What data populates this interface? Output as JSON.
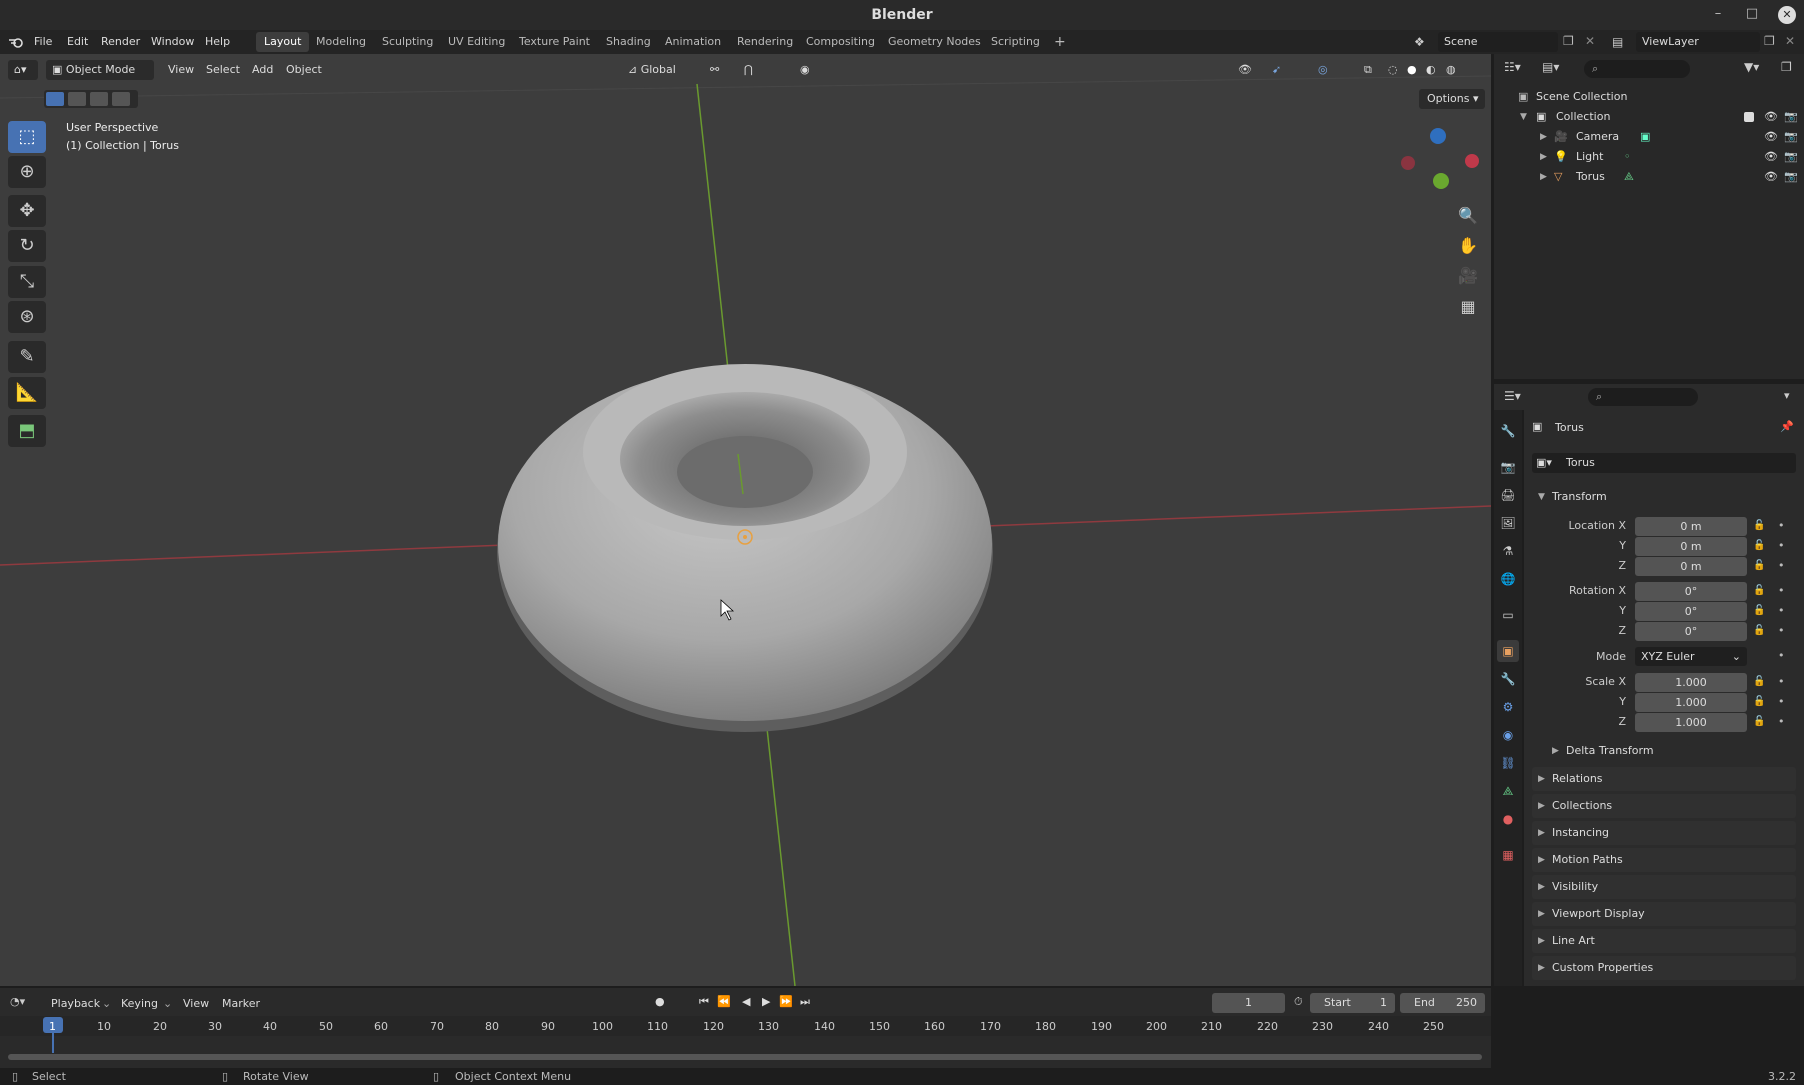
{
  "app": {
    "window_title": "Blender",
    "version": "3.2.2",
    "accent": "#4772b3"
  },
  "menubar": {
    "items": [
      "File",
      "Edit",
      "Render",
      "Window",
      "Help"
    ],
    "workspaces": [
      "Layout",
      "Modeling",
      "Sculpting",
      "UV Editing",
      "Texture Paint",
      "Shading",
      "Animation",
      "Rendering",
      "Compositing",
      "Geometry Nodes",
      "Scripting"
    ],
    "active_workspace": "Layout",
    "scene": "Scene",
    "view_layer": "ViewLayer"
  },
  "viewport": {
    "mode": "Object Mode",
    "menus": [
      "View",
      "Select",
      "Add",
      "Object"
    ],
    "transform_orientation": "Global",
    "options_label": "Options",
    "overlay_title": "User Perspective",
    "overlay_subtitle": "(1) Collection | Torus"
  },
  "outliner": {
    "scene_collection": "Scene Collection",
    "collection": "Collection",
    "objects": [
      "Camera",
      "Light",
      "Torus"
    ]
  },
  "properties": {
    "object_name": "Torus",
    "data_name": "Torus",
    "transform_label": "Transform",
    "location_label": "Location X",
    "rotation_label": "Rotation X",
    "scale_label": "Scale X",
    "y_label": "Y",
    "z_label": "Z",
    "location": [
      "0 m",
      "0 m",
      "0 m"
    ],
    "rotation": [
      "0°",
      "0°",
      "0°"
    ],
    "mode_label": "Mode",
    "mode_value": "XYZ Euler",
    "scale": [
      "1.000",
      "1.000",
      "1.000"
    ],
    "delta_transform": "Delta Transform",
    "panels": [
      "Relations",
      "Collections",
      "Instancing",
      "Motion Paths",
      "Visibility",
      "Viewport Display",
      "Line Art",
      "Custom Properties"
    ]
  },
  "timeline": {
    "menus": [
      "Playback",
      "Keying",
      "View",
      "Marker"
    ],
    "current_frame": "1",
    "start_label": "Start",
    "start_value": "1",
    "end_label": "End",
    "end_value": "250",
    "ruler": [
      "1",
      "10",
      "20",
      "30",
      "40",
      "50",
      "60",
      "70",
      "80",
      "90",
      "100",
      "110",
      "120",
      "130",
      "140",
      "150",
      "160",
      "170",
      "180",
      "190",
      "200",
      "210",
      "220",
      "230",
      "240",
      "250"
    ]
  },
  "statusbar": {
    "select": "Select",
    "rotate": "Rotate View",
    "context": "Object Context Menu"
  }
}
